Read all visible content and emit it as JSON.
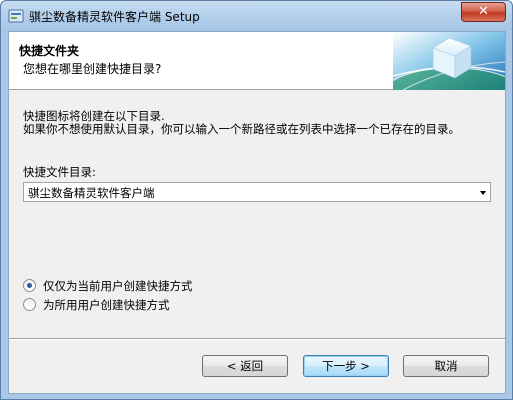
{
  "window": {
    "title": "骐尘数备精灵软件客户端 Setup",
    "close_label": "✕"
  },
  "header": {
    "title": "快捷文件夹",
    "subtitle": "您想在哪里创建快捷目录?"
  },
  "body": {
    "description_line1": "快捷图标将创建在以下目录.",
    "description_line2": "如果你不想使用默认目录，你可以输入一个新路径或在列表中选择一个已存在的目录。",
    "folder_label": "快捷文件目录:",
    "folder_value": "骐尘数备精灵软件客户端",
    "options": [
      {
        "label": "仅仅为当前用户创建快捷方式",
        "selected": true
      },
      {
        "label": "为所用用户创建快捷方式",
        "selected": false
      }
    ]
  },
  "buttons": {
    "back": "< 返回",
    "next": "下一步 >",
    "cancel": "取消"
  },
  "colors": {
    "title_bar": "#b3cfeb",
    "close_button": "#c23a23",
    "client_bg": "#f0f0f0",
    "default_button_border": "#3c7fb1"
  }
}
